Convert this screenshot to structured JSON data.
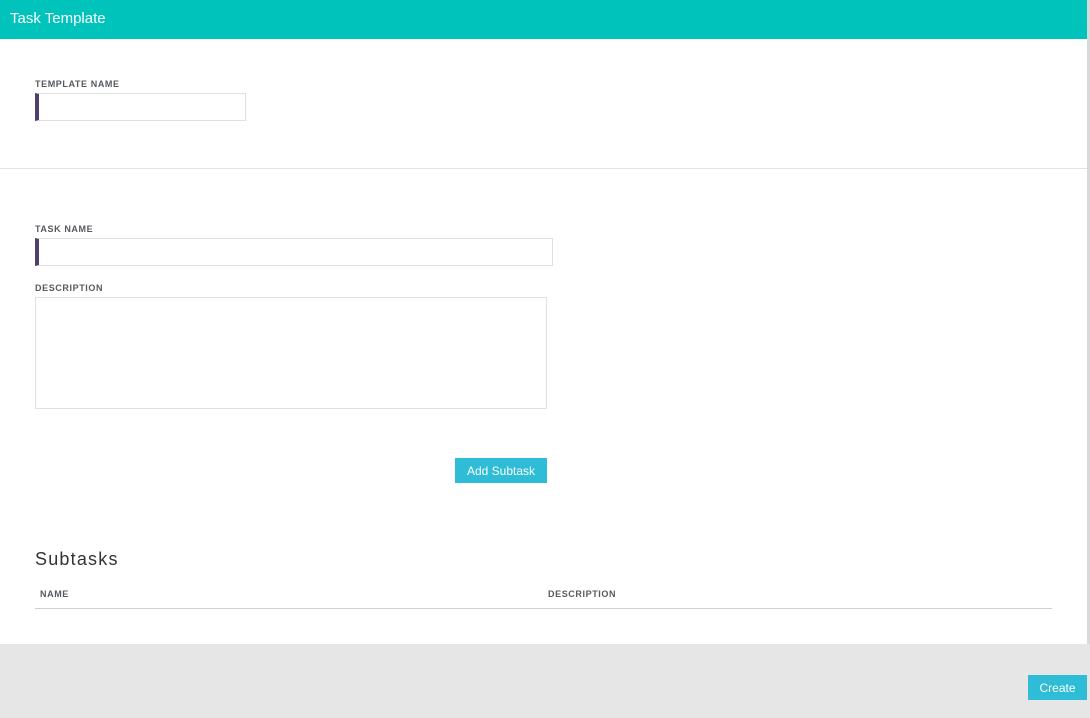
{
  "header": {
    "title": "Task Template"
  },
  "template_section": {
    "template_name_label": "TEMPLATE NAME",
    "template_name_value": ""
  },
  "task_section": {
    "task_name_label": "TASK NAME",
    "task_name_value": "",
    "description_label": "DESCRIPTION",
    "description_value": "",
    "add_subtask_label": "Add Subtask"
  },
  "subtasks": {
    "title": "Subtasks",
    "columns": [
      "NAME",
      "DESCRIPTION"
    ],
    "rows": []
  },
  "footer": {
    "create_label": "Create"
  },
  "colors": {
    "header_bg": "#00c4bb",
    "input_accent": "#4f3f6b",
    "button_bg": "#2ebcd6",
    "footer_bg": "#e6e6e6"
  }
}
